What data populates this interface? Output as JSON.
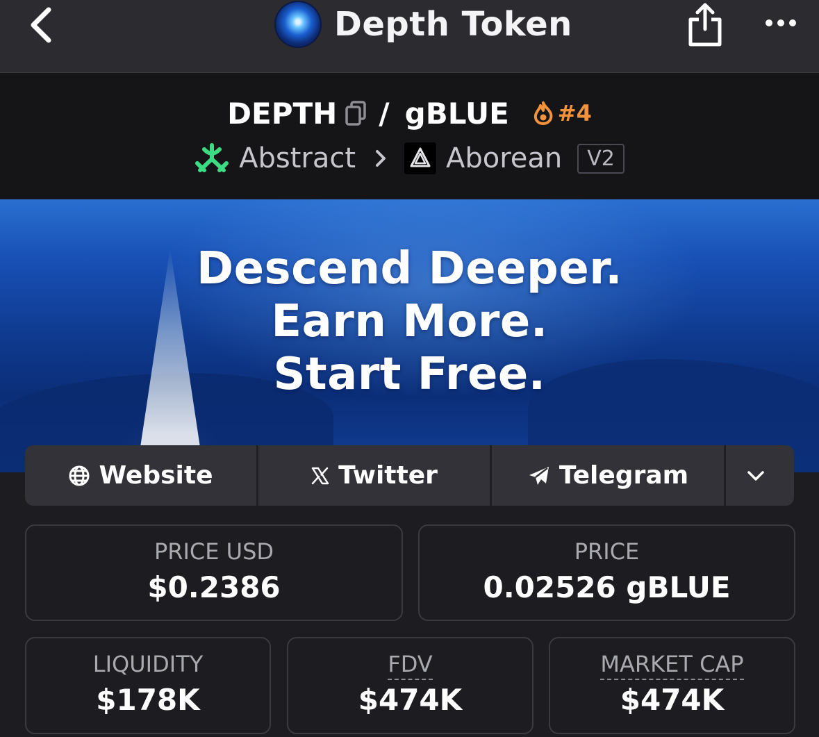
{
  "topbar": {
    "title": "Depth Token",
    "icons": [
      "back-chevron-icon",
      "token-logo",
      "share-icon",
      "more-dots-icon"
    ]
  },
  "pair": {
    "base": "DEPTH",
    "separator": "/",
    "quote": "gBLUE",
    "rank": "#4",
    "rank_icon": "flame-icon",
    "rank_color": "#f2923b"
  },
  "chain": {
    "name": "Abstract",
    "chain_icon": "abstract-logo",
    "chain_color": "#3ddc84",
    "dex": "Aborean",
    "dex_icon": "aborean-logo",
    "version": "V2"
  },
  "banner": {
    "line1": "Descend Deeper.",
    "line2": "Earn More.",
    "line3": "Start Free."
  },
  "links": {
    "website": "Website",
    "twitter": "Twitter",
    "telegram": "Telegram",
    "icons": [
      "globe-icon",
      "x-logo-icon",
      "telegram-plane-icon",
      "chevron-down-icon"
    ]
  },
  "stats": {
    "price_usd_label": "PRICE USD",
    "price_usd_value": "$0.2386",
    "price_label": "PRICE",
    "price_value": "0.02526 gBLUE",
    "liquidity_label": "LIQUIDITY",
    "liquidity_value": "$178K",
    "fdv_label": "FDV",
    "fdv_value": "$474K",
    "mcap_label": "MARKET CAP",
    "mcap_value": "$474K"
  }
}
